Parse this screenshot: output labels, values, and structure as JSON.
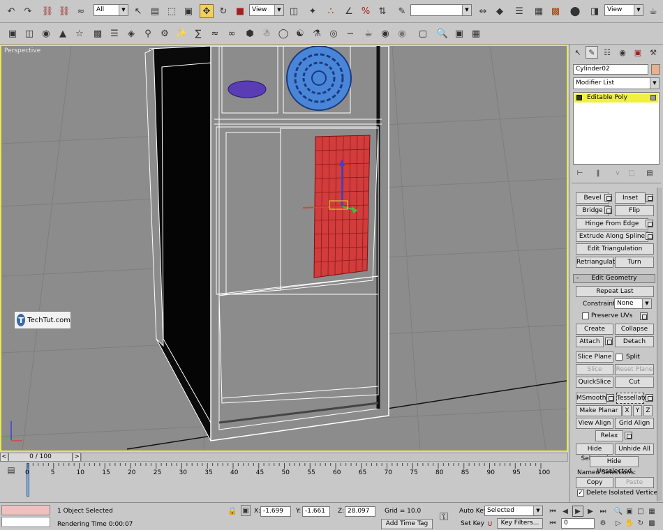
{
  "toolbar1": {
    "selection_filter": "All",
    "ref_coord": "View",
    "named_selection": "",
    "view_dropdown": "View"
  },
  "viewport": {
    "label": "Perspective",
    "watermark": "TechTut.com",
    "watermark_logo": "T"
  },
  "command_panel": {
    "object_name": "Cylinder02",
    "modifier_list": "Modifier List",
    "stack_item": "Editable Poly",
    "edit_polygons": {
      "bevel": "Bevel",
      "inset": "Inset",
      "bridge": "Bridge",
      "flip": "Flip",
      "hinge_from_edge": "Hinge From Edge",
      "extrude_along_spline": "Extrude Along Spline",
      "edit_triangulation": "Edit Triangulation",
      "retriangulate": "Retriangulate",
      "turn": "Turn"
    },
    "edit_geometry": {
      "rollout_sign": "-",
      "rollout_title": "Edit Geometry",
      "repeat_last": "Repeat Last",
      "constraints_label": "Constraints:",
      "constraints_value": "None",
      "preserve_uvs": "Preserve UVs",
      "create": "Create",
      "collapse": "Collapse",
      "attach": "Attach",
      "detach": "Detach",
      "slice_plane": "Slice Plane",
      "split": "Split",
      "slice": "Slice",
      "reset_plane": "Reset Plane",
      "quickslice": "QuickSlice",
      "cut": "Cut",
      "msmooth": "MSmooth",
      "tessellate": "Tessellate",
      "make_planar": "Make Planar",
      "x": "X",
      "y": "Y",
      "z": "Z",
      "view_align": "View Align",
      "grid_align": "Grid Align",
      "relax": "Relax",
      "hide_selected": "Hide Selected",
      "unhide_all": "Unhide All",
      "hide_unselected": "Hide Unselected",
      "named_selections": "Named Selections:",
      "copy": "Copy",
      "paste": "Paste",
      "delete_isolated": "Delete Isolated Vertices"
    }
  },
  "timeline": {
    "frame_counter": "0 / 100",
    "ticks": [
      "0",
      "5",
      "10",
      "15",
      "20",
      "25",
      "30",
      "35",
      "40",
      "45",
      "50",
      "55",
      "60",
      "65",
      "70",
      "75",
      "80",
      "85",
      "90",
      "95",
      "100"
    ]
  },
  "status": {
    "selection_info": "1 Object Selected",
    "rendering_time": "Rendering Time  0:00:07",
    "x_label": "X:",
    "x_value": "-1.699",
    "y_label": "Y:",
    "y_value": "-1.661",
    "z_label": "Z:",
    "z_value": "28.097",
    "grid": "Grid = 10.0",
    "add_time_tag": "Add Time Tag",
    "auto_key": "Auto Key",
    "set_key": "Set Key",
    "key_mode": "Selected",
    "key_filters": "Key Filters...",
    "current_frame": "0"
  },
  "colors": {
    "viewport_bg": "#8c8c8c",
    "viewport_border": "#e8e84a",
    "selected_face": "#d23c3c",
    "fan_blue": "#4a86d8",
    "button_purple": "#5a3cb4",
    "stack_highlight": "#f0f040"
  }
}
